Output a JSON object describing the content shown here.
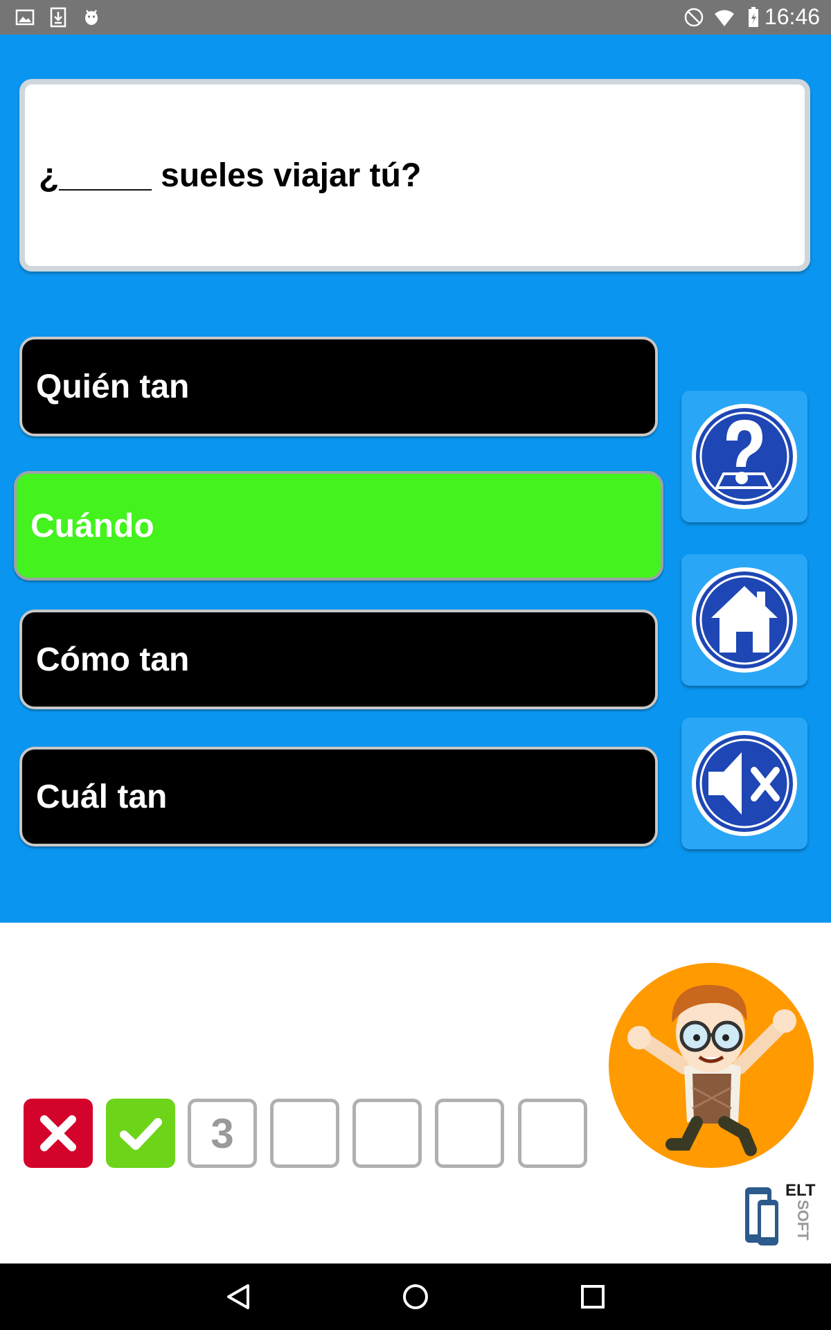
{
  "status_bar": {
    "time": "16:46",
    "icons": [
      "image-icon",
      "download-icon",
      "android-icon",
      "no-disturb-icon",
      "wifi-icon",
      "battery-icon"
    ]
  },
  "question": {
    "text": "¿_____ sueles viajar tú?"
  },
  "answers": [
    {
      "label": "Quién tan",
      "state": "default"
    },
    {
      "label": "Cuándo",
      "state": "correct"
    },
    {
      "label": "Cómo tan",
      "state": "default"
    },
    {
      "label": "Cuál tan",
      "state": "default"
    }
  ],
  "side_buttons": [
    "help-icon",
    "home-icon",
    "mute-icon"
  ],
  "score": {
    "slots": [
      {
        "state": "wrong",
        "icon": "cross-icon"
      },
      {
        "state": "right",
        "icon": "check-icon"
      },
      {
        "state": "current",
        "number": "3"
      },
      {
        "state": "empty"
      },
      {
        "state": "empty"
      },
      {
        "state": "empty"
      },
      {
        "state": "empty"
      }
    ]
  },
  "logo": {
    "text_top": "ELT",
    "text_side": "SOFT"
  },
  "colors": {
    "game_background": "#0a96f0",
    "correct_answer": "#44f21e",
    "default_answer": "#000000",
    "wrong_slot": "#d4032c",
    "right_slot": "#6dd41a",
    "mascot_circle": "#ff9a00",
    "icon_circle": "#1e46b4"
  },
  "nav_bar": {
    "buttons": [
      "back-icon",
      "home-circle-icon",
      "recents-icon"
    ]
  }
}
